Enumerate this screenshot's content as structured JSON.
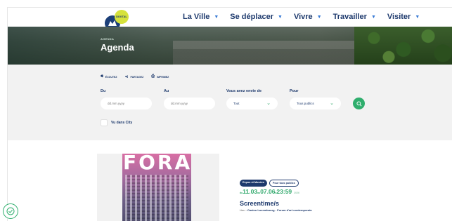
{
  "logo": {
    "badge_text": "DIGITAL",
    "caption": "VILLE DE LUXEMBOURG"
  },
  "nav": [
    {
      "label": "La Ville"
    },
    {
      "label": "Se déplacer"
    },
    {
      "label": "Vivre"
    },
    {
      "label": "Travailler"
    },
    {
      "label": "Visiter"
    }
  ],
  "hero": {
    "section_label": "AGENDA",
    "title": "Agenda"
  },
  "share": [
    {
      "icon": "speaker-icon",
      "label": "ÉCOUTEZ"
    },
    {
      "icon": "share-icon",
      "label": "PARTAGEZ"
    },
    {
      "icon": "print-icon",
      "label": "IMPRIMEZ"
    }
  ],
  "filters": {
    "from_label": "Du",
    "from_placeholder": "dd.mm.yyyy",
    "to_label": "Au",
    "to_placeholder": "dd.mm.yyyy",
    "want_label": "Vous avez envie de",
    "want_value": "Tout",
    "for_label": "Pour",
    "for_value": "Tous publics",
    "checkbox_label": "Vu dans City"
  },
  "event": {
    "poster_title": "FORA",
    "tags": [
      "Expos et Musées",
      "Pour tous publics"
    ],
    "date_prefix_from": "du",
    "date_start": "11.03",
    "date_prefix_to": "au",
    "date_end": "07.06",
    "time_sep": "à",
    "time": "23:59",
    "year": "2026",
    "title": "Screentime/s",
    "place_prefix": "Lieu : ",
    "place": "Casino Luxembourg - Forum d'art contemporain"
  },
  "colors": {
    "brand_blue": "#1e3a6d",
    "accent_green": "#2fae6d",
    "panel_bg": "#f2f2f2"
  }
}
